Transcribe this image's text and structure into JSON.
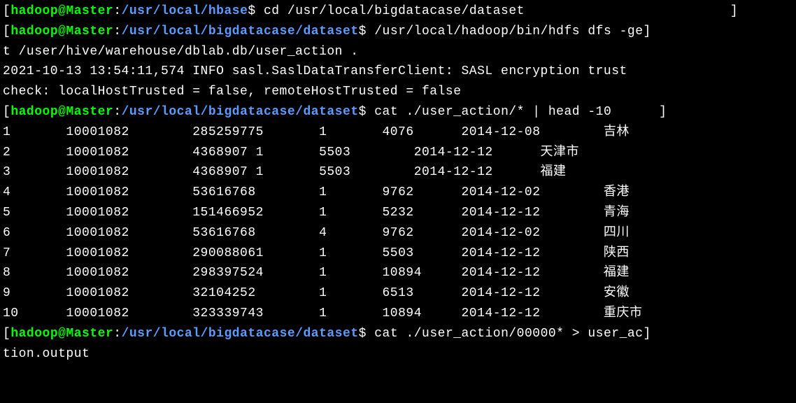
{
  "prompts": [
    {
      "user": "hadoop",
      "host": "Master",
      "path": "/usr/local/hbase",
      "cmd": "cd /usr/local/bigdatacase/dataset"
    },
    {
      "user": "hadoop",
      "host": "Master",
      "path": "/usr/local/bigdatacase/dataset",
      "cmd": "/usr/local/hadoop/bin/hdfs dfs -ge",
      "cont": "t /user/hive/warehouse/dblab.db/user_action ."
    }
  ],
  "log1": "2021-10-13 13:54:11,574 INFO sasl.SaslDataTransferClient: SASL encryption trust",
  "log2": "check: localHostTrusted = false, remoteHostTrusted = false",
  "prompt3": {
    "user": "hadoop",
    "host": "Master",
    "path": "/usr/local/bigdatacase/dataset",
    "cmd": "cat ./user_action/* | head -10"
  },
  "rows": [
    {
      "c1": "1",
      "c2": "10001082",
      "c3": "285259775",
      "c4": "1",
      "c5": "4076",
      "c6": "2014-12-08",
      "c7": "吉林"
    },
    {
      "c1": "2",
      "c2": "10001082",
      "c3": "4368907 1",
      "c4": "5503",
      "c5": "2014-12-12",
      "c6": "天津市",
      "c7": ""
    },
    {
      "c1": "3",
      "c2": "10001082",
      "c3": "4368907 1",
      "c4": "5503",
      "c5": "2014-12-12",
      "c6": "福建",
      "c7": ""
    },
    {
      "c1": "4",
      "c2": "10001082",
      "c3": "53616768",
      "c4": "1",
      "c5": "9762",
      "c6": "2014-12-02",
      "c7": "香港"
    },
    {
      "c1": "5",
      "c2": "10001082",
      "c3": "151466952",
      "c4": "1",
      "c5": "5232",
      "c6": "2014-12-12",
      "c7": "青海"
    },
    {
      "c1": "6",
      "c2": "10001082",
      "c3": "53616768",
      "c4": "4",
      "c5": "9762",
      "c6": "2014-12-02",
      "c7": "四川"
    },
    {
      "c1": "7",
      "c2": "10001082",
      "c3": "290088061",
      "c4": "1",
      "c5": "5503",
      "c6": "2014-12-12",
      "c7": "陕西"
    },
    {
      "c1": "8",
      "c2": "10001082",
      "c3": "298397524",
      "c4": "1",
      "c5": "10894",
      "c6": "2014-12-12",
      "c7": "福建"
    },
    {
      "c1": "9",
      "c2": "10001082",
      "c3": "32104252",
      "c4": "1",
      "c5": "6513",
      "c6": "2014-12-12",
      "c7": "安徽"
    },
    {
      "c1": "10",
      "c2": "10001082",
      "c3": "323339743",
      "c4": "1",
      "c5": "10894",
      "c6": "2014-12-12",
      "c7": "重庆市"
    }
  ],
  "prompt4": {
    "user": "hadoop",
    "host": "Master",
    "path": "/usr/local/bigdatacase/dataset",
    "cmd": "cat ./user_action/00000* > user_ac",
    "cont": "tion.output"
  }
}
